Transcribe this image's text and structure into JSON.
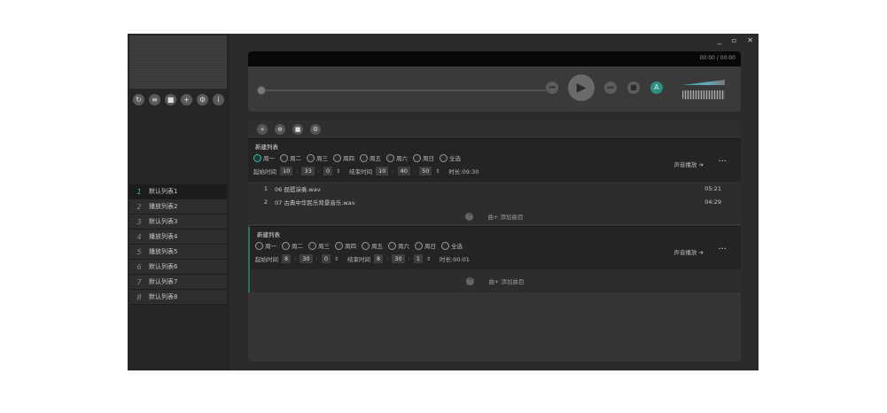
{
  "window": {
    "controls": [
      "_",
      "▫",
      "✕"
    ]
  },
  "sidebar": {
    "tool_icons": [
      "↻",
      "≡",
      "■",
      "+",
      "⚙",
      "i"
    ],
    "playlists": [
      {
        "num": "1",
        "name": "默认列表1"
      },
      {
        "num": "2",
        "name": "播放列表2"
      },
      {
        "num": "3",
        "name": "默认列表3"
      },
      {
        "num": "4",
        "name": "播放列表4"
      },
      {
        "num": "5",
        "name": "播放列表5"
      },
      {
        "num": "6",
        "name": "默认列表6"
      },
      {
        "num": "7",
        "name": "默认列表7"
      },
      {
        "num": "8",
        "name": "默认列表8"
      }
    ]
  },
  "player": {
    "time": "00:00 / 00:00",
    "mode_label": "A",
    "progress": 0
  },
  "toolbar": {
    "icons": [
      "+",
      "⊕",
      "■",
      "⚙"
    ]
  },
  "tasks": [
    {
      "name": "新建列表",
      "days": [
        "周一",
        "周二",
        "周三",
        "周四",
        "周五",
        "周六",
        "周日",
        "全选"
      ],
      "start_label": "起始时间",
      "start_h": "10",
      "start_m": "33",
      "start_s": "0",
      "end_label": "结束时间",
      "end_h": "10",
      "end_m": "40",
      "end_s": "50",
      "duration": "时长:09:30",
      "sound_label": "声音播放",
      "songs": [
        {
          "idx": "1",
          "title": "06 琵琶演奏.wav",
          "dur": "05:21"
        },
        {
          "idx": "2",
          "title": "07 古典中华民乐背景音乐.wav",
          "dur": "04:29"
        }
      ],
      "add_label": "曲+ 添加曲目"
    },
    {
      "name": "新建列表",
      "days": [
        "周一",
        "周二",
        "周三",
        "周四",
        "周五",
        "周六",
        "周日",
        "全选"
      ],
      "start_label": "起始时间",
      "start_h": "8",
      "start_m": "30",
      "start_s": "0",
      "end_label": "结束时间",
      "end_h": "8",
      "end_m": "30",
      "end_s": "1",
      "duration": "时长:00:01",
      "sound_label": "声音播放",
      "add_label": "曲+ 添加曲目"
    }
  ]
}
